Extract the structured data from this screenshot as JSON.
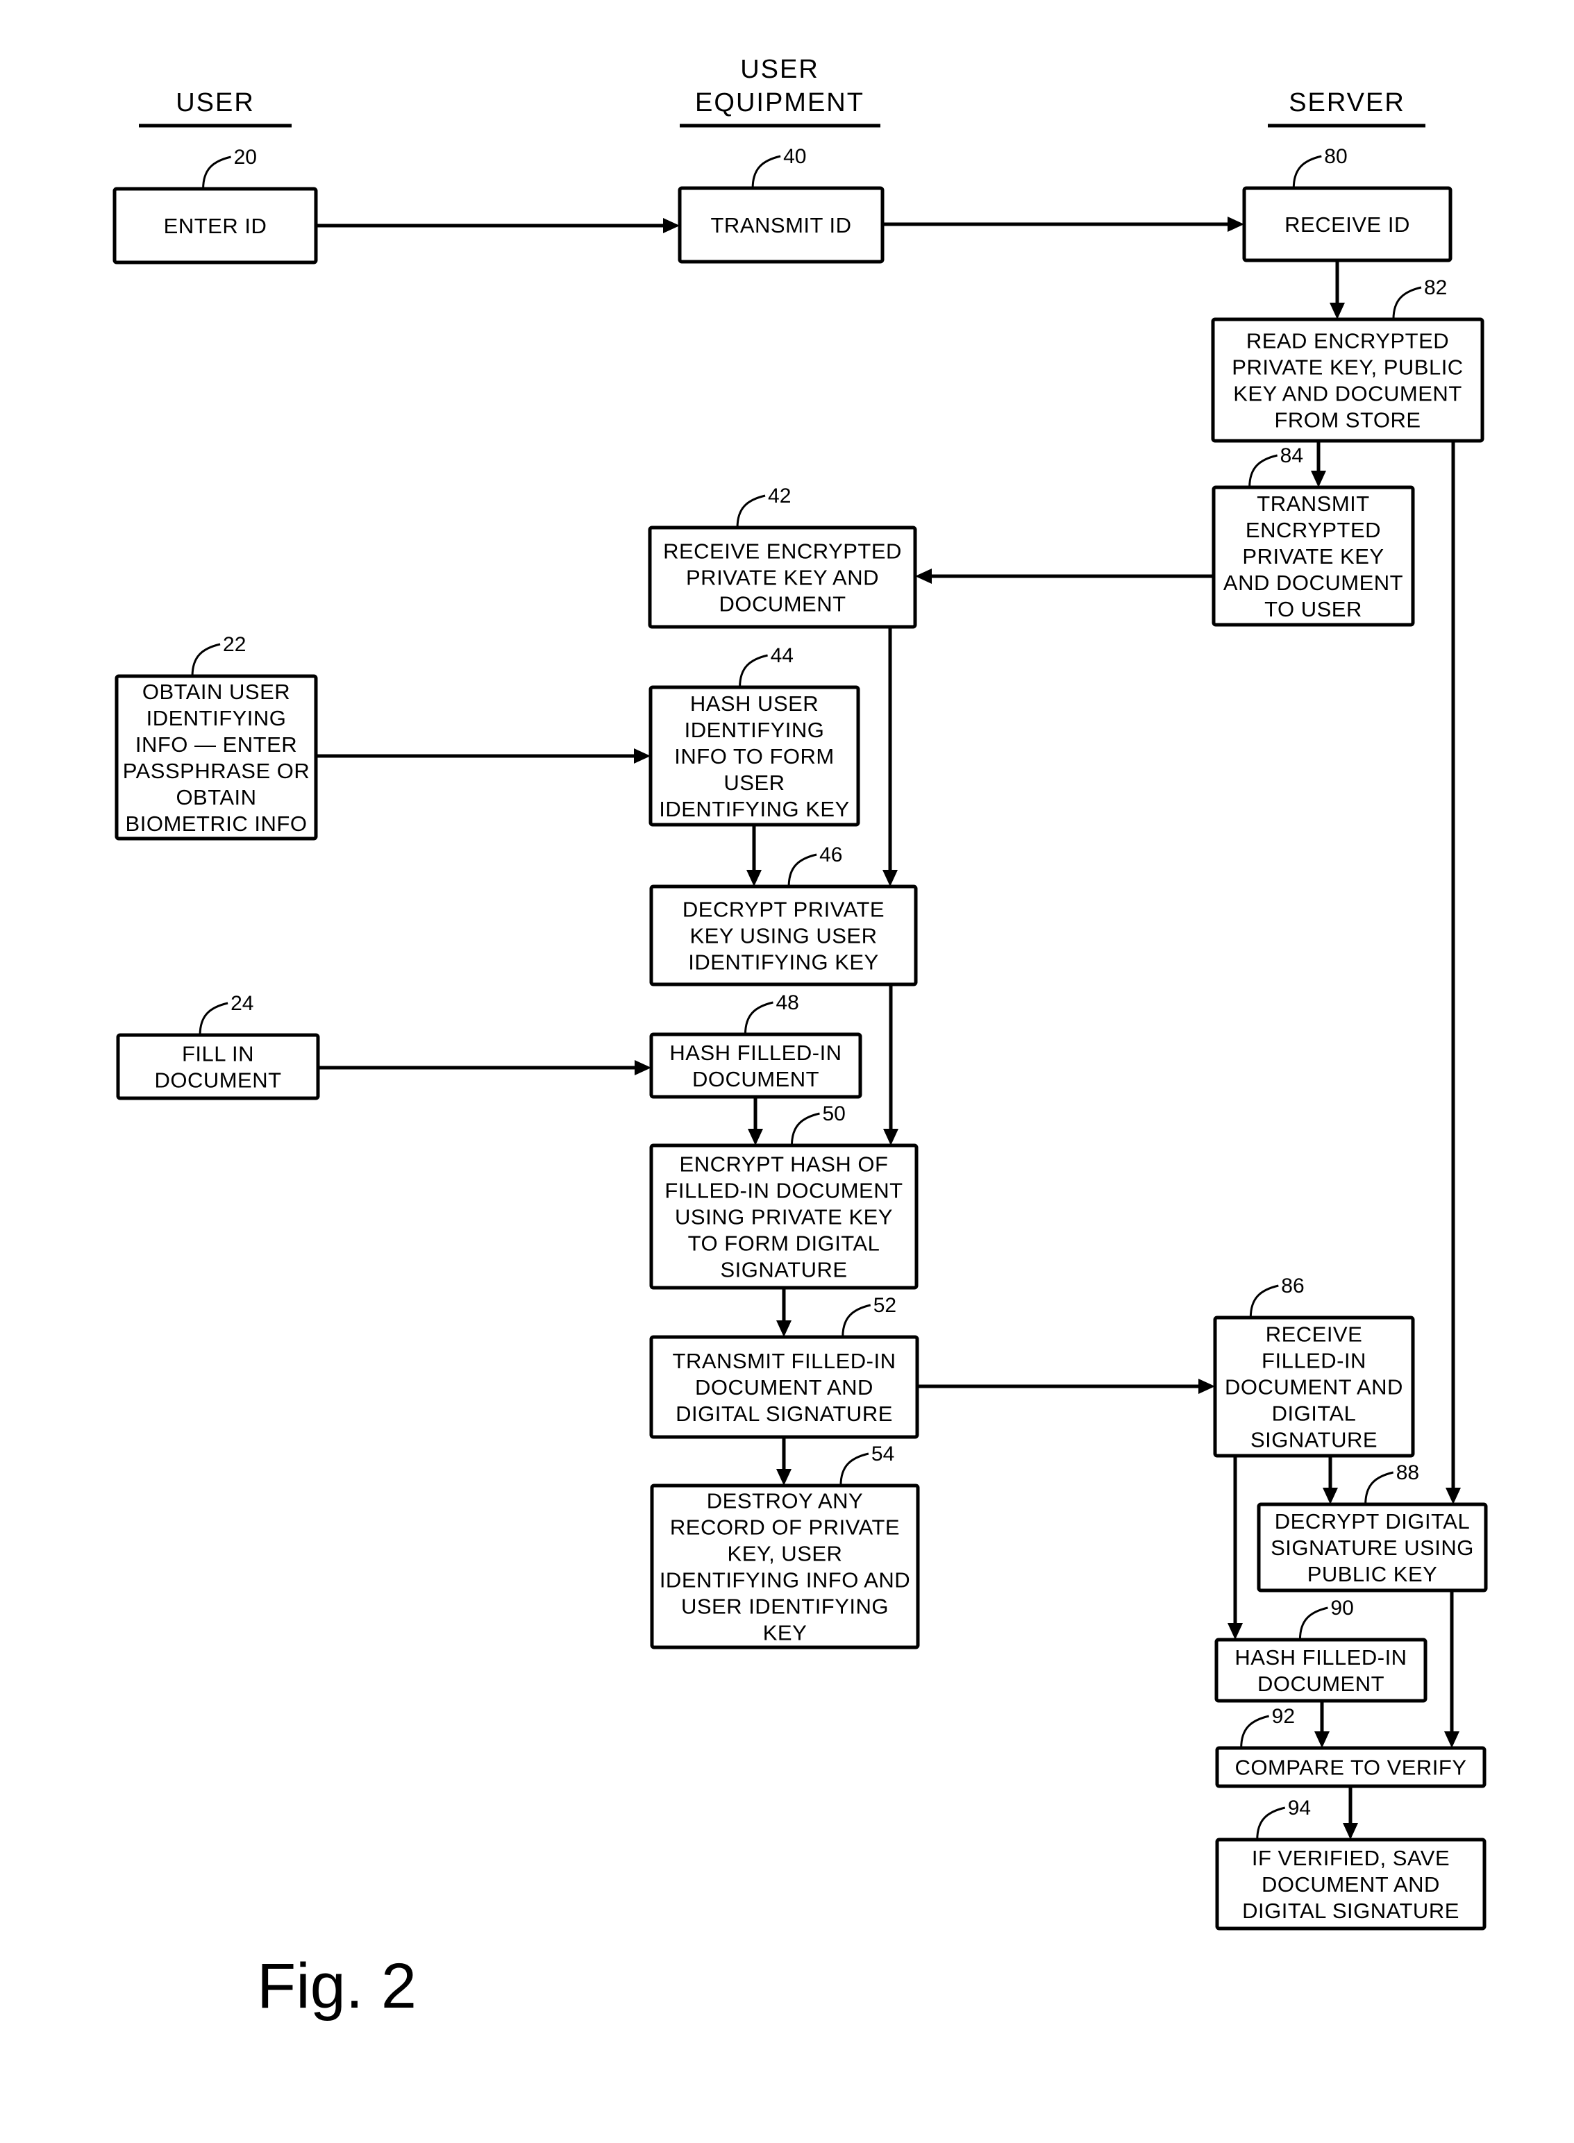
{
  "figure": {
    "label": "Fig. 2"
  },
  "columns": [
    {
      "id": "user",
      "lines": [
        "USER"
      ]
    },
    {
      "id": "user-equipment",
      "lines": [
        "USER",
        "EQUIPMENT"
      ]
    },
    {
      "id": "server",
      "lines": [
        "SERVER"
      ]
    }
  ],
  "steps": [
    {
      "ref": "20",
      "column": "user",
      "lines": [
        "ENTER ID"
      ]
    },
    {
      "ref": "22",
      "column": "user",
      "lines": [
        "OBTAIN USER",
        "IDENTIFYING",
        "INFO — ENTER",
        "PASSPHRASE OR",
        "OBTAIN",
        "BIOMETRIC INFO"
      ]
    },
    {
      "ref": "24",
      "column": "user",
      "lines": [
        "FILL IN",
        "DOCUMENT"
      ]
    },
    {
      "ref": "40",
      "column": "user-equipment",
      "lines": [
        "TRANSMIT ID"
      ]
    },
    {
      "ref": "42",
      "column": "user-equipment",
      "lines": [
        "RECEIVE ENCRYPTED",
        "PRIVATE KEY AND",
        "DOCUMENT"
      ]
    },
    {
      "ref": "44",
      "column": "user-equipment",
      "lines": [
        "HASH USER",
        "IDENTIFYING",
        "INFO TO FORM",
        "USER",
        "IDENTIFYING KEY"
      ]
    },
    {
      "ref": "46",
      "column": "user-equipment",
      "lines": [
        "DECRYPT PRIVATE",
        "KEY USING USER",
        "IDENTIFYING KEY"
      ]
    },
    {
      "ref": "48",
      "column": "user-equipment",
      "lines": [
        "HASH FILLED-IN",
        "DOCUMENT"
      ]
    },
    {
      "ref": "50",
      "column": "user-equipment",
      "lines": [
        "ENCRYPT HASH OF",
        "FILLED-IN DOCUMENT",
        "USING PRIVATE KEY",
        "TO FORM DIGITAL",
        "SIGNATURE"
      ]
    },
    {
      "ref": "52",
      "column": "user-equipment",
      "lines": [
        "TRANSMIT FILLED-IN",
        "DOCUMENT AND",
        "DIGITAL SIGNATURE"
      ]
    },
    {
      "ref": "54",
      "column": "user-equipment",
      "lines": [
        "DESTROY ANY",
        "RECORD OF PRIVATE",
        "KEY, USER",
        "IDENTIFYING INFO AND",
        "USER IDENTIFYING",
        "KEY"
      ]
    },
    {
      "ref": "80",
      "column": "server",
      "lines": [
        "RECEIVE ID"
      ]
    },
    {
      "ref": "82",
      "column": "server",
      "lines": [
        "READ ENCRYPTED",
        "PRIVATE KEY, PUBLIC",
        "KEY AND DOCUMENT",
        "FROM STORE"
      ]
    },
    {
      "ref": "84",
      "column": "server",
      "lines": [
        "TRANSMIT",
        "ENCRYPTED",
        "PRIVATE KEY",
        "AND DOCUMENT",
        "TO USER"
      ]
    },
    {
      "ref": "86",
      "column": "server",
      "lines": [
        "RECEIVE",
        "FILLED-IN",
        "DOCUMENT AND",
        "DIGITAL",
        "SIGNATURE"
      ]
    },
    {
      "ref": "88",
      "column": "server",
      "lines": [
        "DECRYPT DIGITAL",
        "SIGNATURE USING",
        "PUBLIC KEY"
      ]
    },
    {
      "ref": "90",
      "column": "server",
      "lines": [
        "HASH FILLED-IN",
        "DOCUMENT"
      ]
    },
    {
      "ref": "92",
      "column": "server",
      "lines": [
        "COMPARE TO VERIFY"
      ]
    },
    {
      "ref": "94",
      "column": "server",
      "lines": [
        "IF VERIFIED, SAVE",
        "DOCUMENT AND",
        "DIGITAL SIGNATURE"
      ]
    }
  ],
  "flows": [
    {
      "from": "20",
      "to": "40"
    },
    {
      "from": "40",
      "to": "80"
    },
    {
      "from": "80",
      "to": "82"
    },
    {
      "from": "82",
      "to": "84"
    },
    {
      "from": "82",
      "to": "88"
    },
    {
      "from": "84",
      "to": "42"
    },
    {
      "from": "22",
      "to": "44"
    },
    {
      "from": "42",
      "to": "46"
    },
    {
      "from": "44",
      "to": "46"
    },
    {
      "from": "24",
      "to": "48"
    },
    {
      "from": "46",
      "to": "50"
    },
    {
      "from": "48",
      "to": "50"
    },
    {
      "from": "50",
      "to": "52"
    },
    {
      "from": "52",
      "to": "54"
    },
    {
      "from": "52",
      "to": "86"
    },
    {
      "from": "86",
      "to": "88"
    },
    {
      "from": "86",
      "to": "90"
    },
    {
      "from": "88",
      "to": "92"
    },
    {
      "from": "90",
      "to": "92"
    },
    {
      "from": "92",
      "to": "94"
    }
  ]
}
